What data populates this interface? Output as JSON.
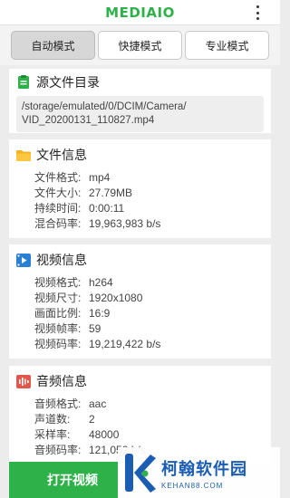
{
  "app": {
    "brand": "MEDIAIO"
  },
  "tabs": [
    {
      "label": "自动模式",
      "active": true
    },
    {
      "label": "快捷模式",
      "active": false
    },
    {
      "label": "专业模式",
      "active": false
    }
  ],
  "source": {
    "title": "源文件目录",
    "path_line1": "/storage/emulated/0/DCIM/Camera/",
    "path_line2": "VID_20200131_110827.mp4"
  },
  "file_info": {
    "title": "文件信息",
    "rows": [
      {
        "k": "文件格式:",
        "v": "mp4"
      },
      {
        "k": "文件大小:",
        "v": "27.79MB"
      },
      {
        "k": "持续时间:",
        "v": "0:00:11"
      },
      {
        "k": "混合码率:",
        "v": "19,963,983 b/s"
      }
    ]
  },
  "video_info": {
    "title": "视频信息",
    "rows": [
      {
        "k": "视频格式:",
        "v": "h264"
      },
      {
        "k": "视频尺寸:",
        "v": "1920x1080"
      },
      {
        "k": "画面比例:",
        "v": "16:9"
      },
      {
        "k": "视频帧率:",
        "v": "59"
      },
      {
        "k": "视频码率:",
        "v": "19,219,422 b/s"
      }
    ]
  },
  "audio_info": {
    "title": "音频信息",
    "rows": [
      {
        "k": "音频格式:",
        "v": "aac"
      },
      {
        "k": "声道数:",
        "v": "2"
      },
      {
        "k": "采样率:",
        "v": "48000"
      },
      {
        "k": "音频码率:",
        "v": "121,052 b/s"
      }
    ]
  },
  "bottom": {
    "button_label": "打开视频"
  },
  "watermark": {
    "name": "柯翰软件园",
    "site": "KEHAN88.COM"
  },
  "colors": {
    "brand_green": "#2fb14a",
    "watermark_blue": "#1a5db3"
  }
}
